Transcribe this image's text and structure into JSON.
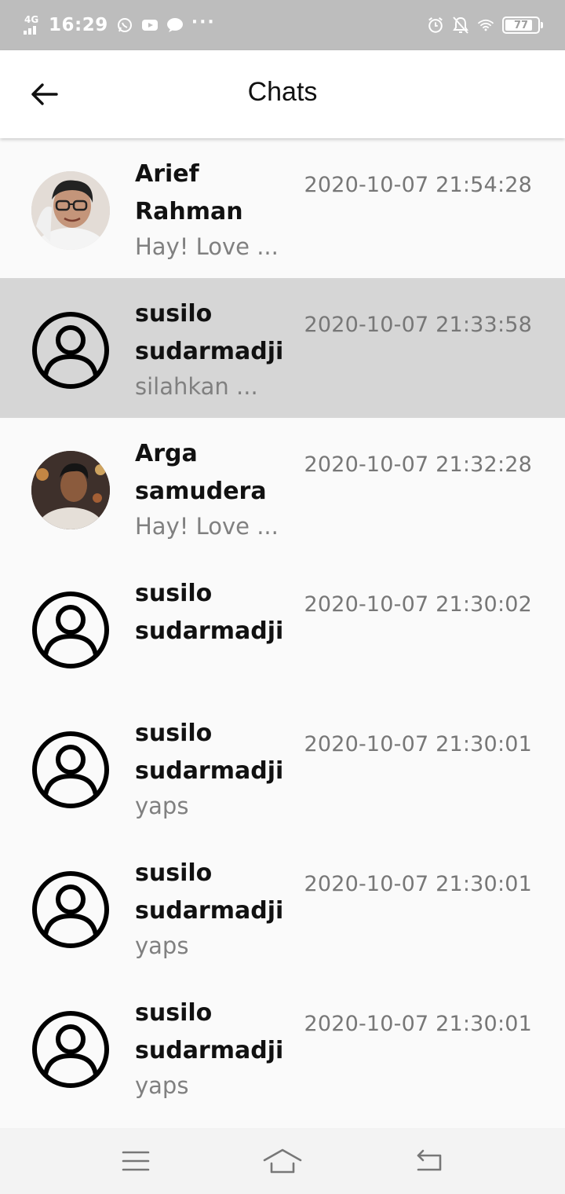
{
  "status_bar": {
    "network": "4G",
    "time": "16:29",
    "notification_icons": [
      "whatsapp-icon",
      "youtube-icon",
      "chat-bubble-icon",
      "more-dots-icon"
    ],
    "more": "···",
    "right_icons": [
      "alarm-icon",
      "notifications-off-icon",
      "wifi-icon"
    ],
    "battery": "77"
  },
  "app_bar": {
    "title": "Chats",
    "back_icon": "arrow-left-icon"
  },
  "chats": [
    {
      "name": "Arief Rahman",
      "preview": "Hay! Love ...",
      "time": "2020-10-07 21:54:28",
      "avatar": "photo",
      "selected": false
    },
    {
      "name": "susilo sudarmadji",
      "preview": "silahkan ...",
      "time": "2020-10-07 21:33:58",
      "avatar": "default-account-icon",
      "selected": true
    },
    {
      "name": "Arga samudera",
      "preview": "Hay! Love ...",
      "time": "2020-10-07 21:32:28",
      "avatar": "photo",
      "selected": false
    },
    {
      "name": "susilo sudarmadji",
      "preview": "",
      "time": "2020-10-07 21:30:02",
      "avatar": "default-account-icon",
      "selected": false
    },
    {
      "name": "susilo sudarmadji",
      "preview": "yaps",
      "time": "2020-10-07 21:30:01",
      "avatar": "default-account-icon",
      "selected": false
    },
    {
      "name": "susilo sudarmadji",
      "preview": "yaps",
      "time": "2020-10-07 21:30:01",
      "avatar": "default-account-icon",
      "selected": false
    },
    {
      "name": "susilo sudarmadji",
      "preview": "yaps",
      "time": "2020-10-07 21:30:01",
      "avatar": "default-account-icon",
      "selected": false
    }
  ],
  "nav_bar": {
    "icons": [
      "menu-icon",
      "home-icon",
      "back-icon"
    ]
  },
  "colors": {
    "status_bar_bg": "#bdbdbd",
    "selected_row_bg": "#d6d6d6",
    "muted_text": "#808080"
  }
}
